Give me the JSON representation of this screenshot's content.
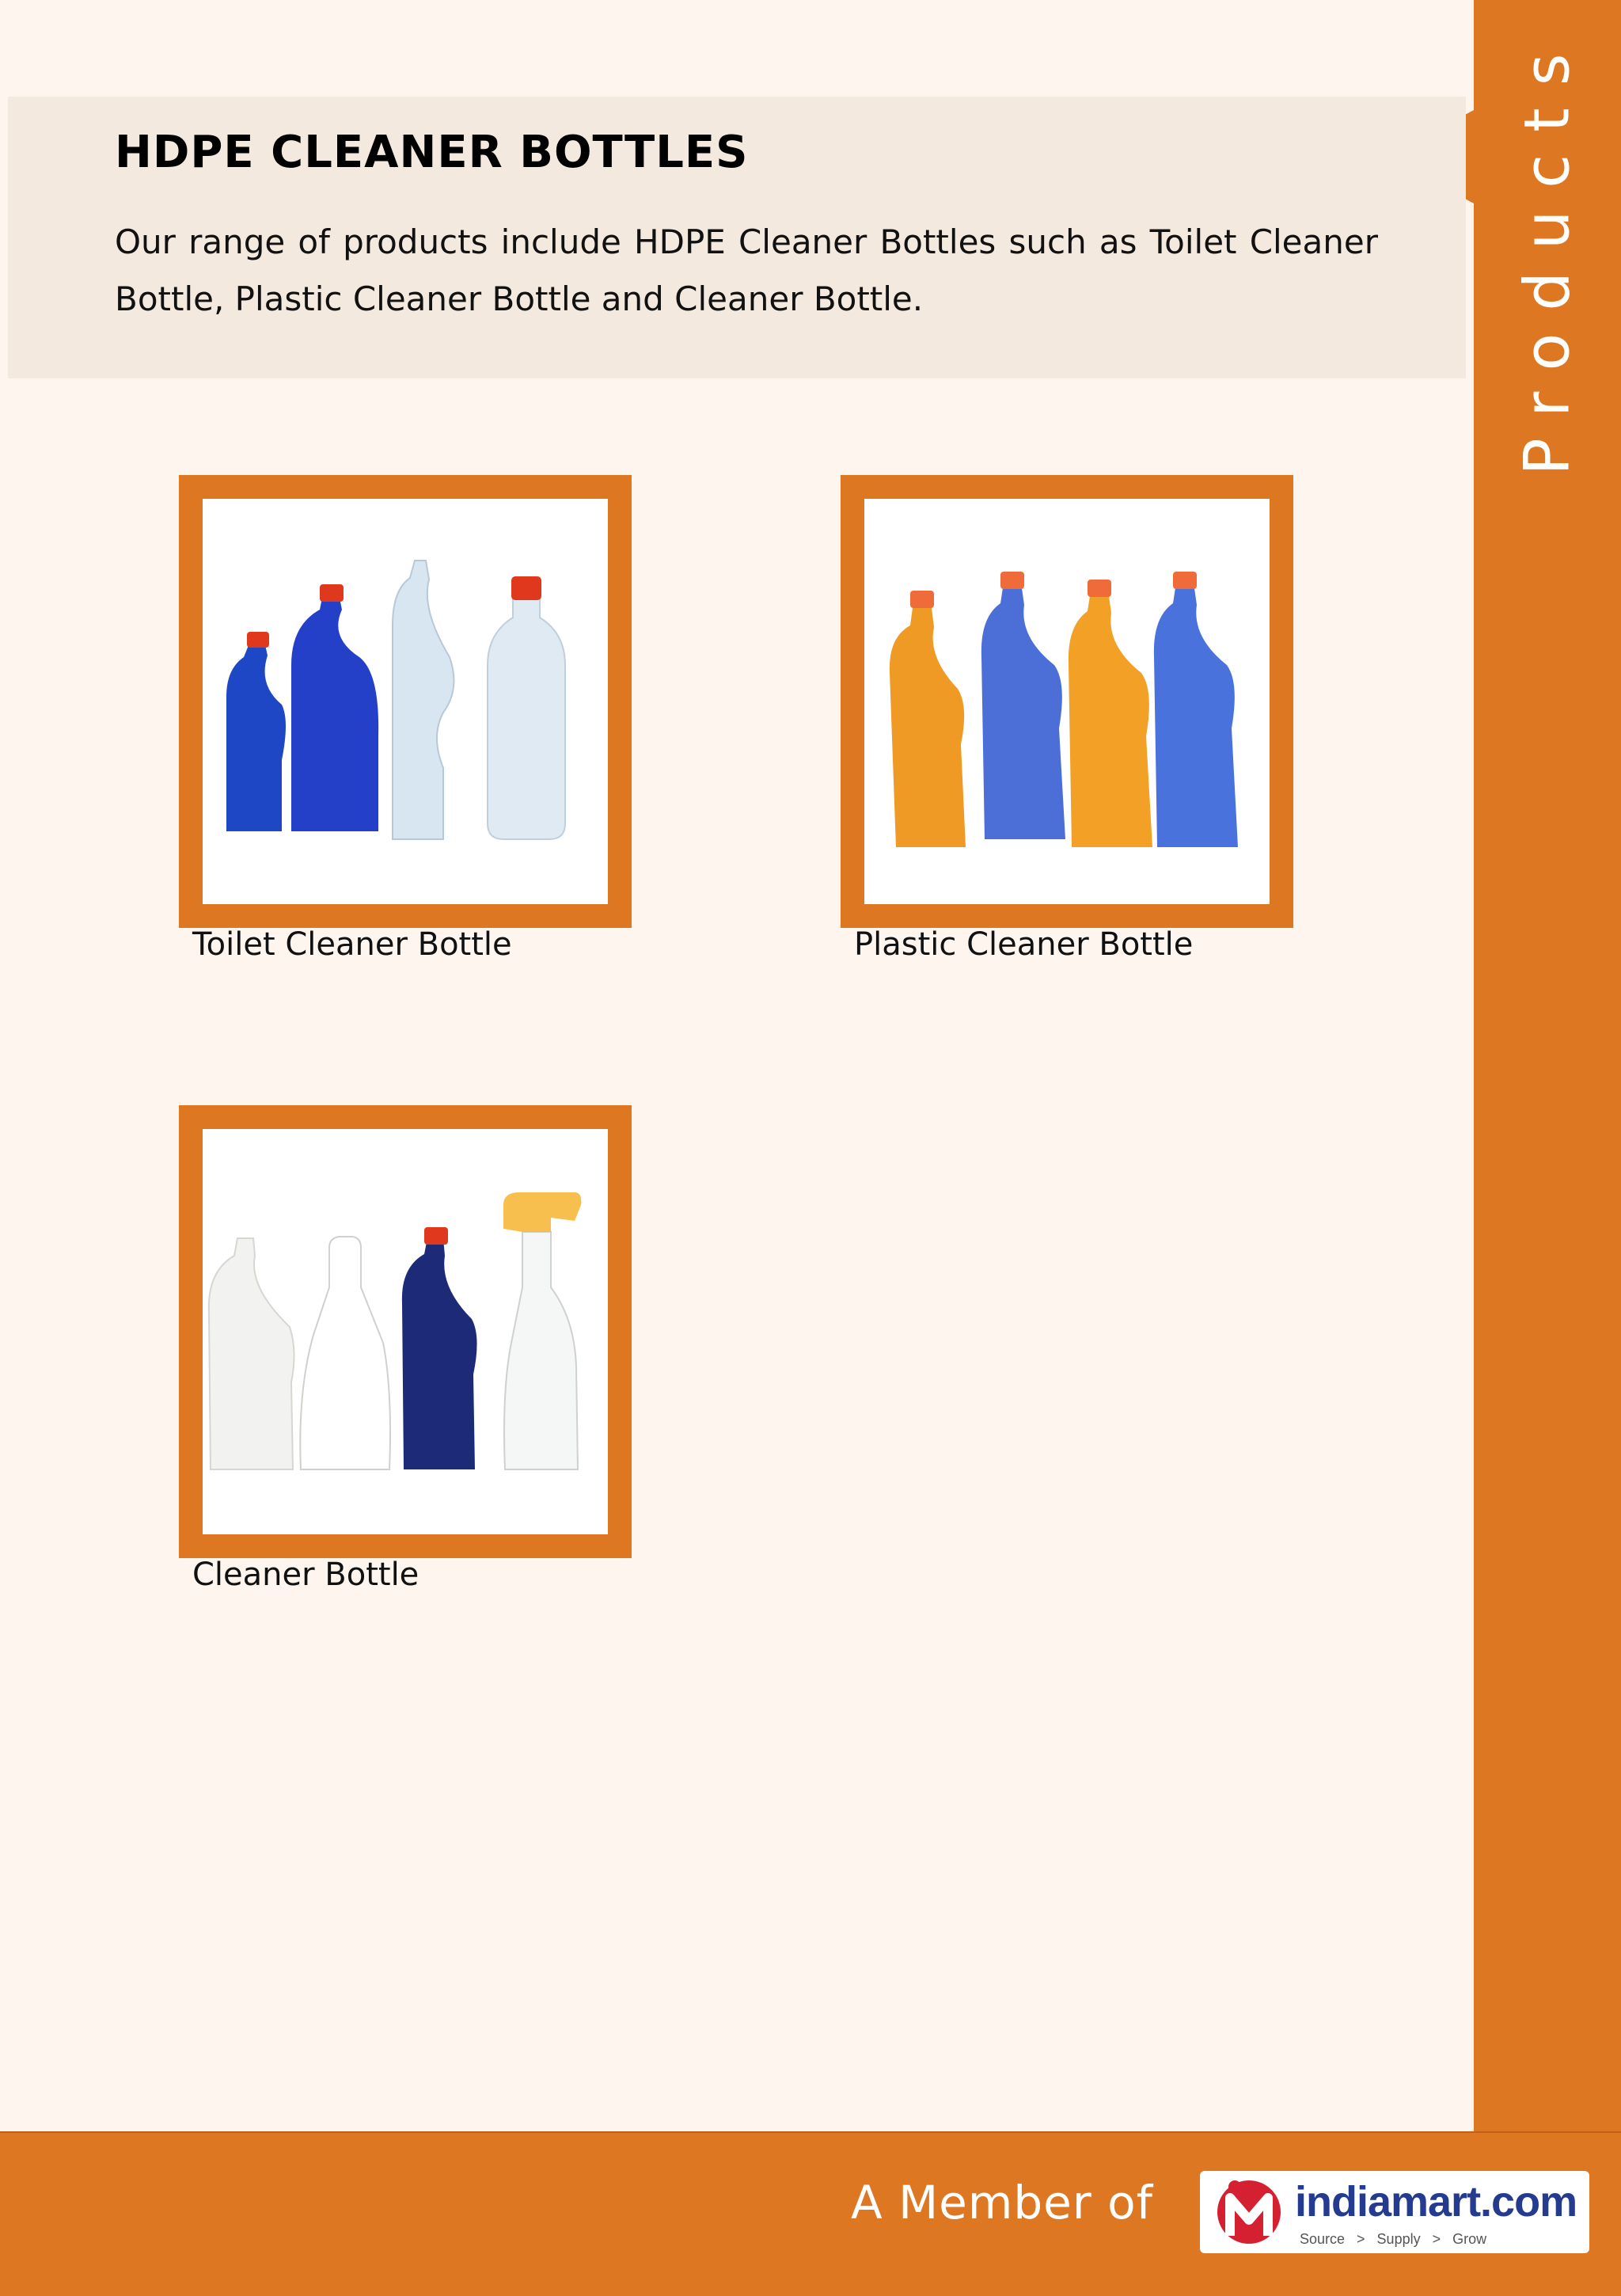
{
  "sidebar": {
    "label": "Products"
  },
  "header": {
    "title": "HDPE CLEANER BOTTLES",
    "description": "Our range of products include HDPE Cleaner Bottles such as Toilet Cleaner Bottle, Plastic Cleaner Bottle and Cleaner Bottle."
  },
  "products": [
    {
      "name": "Toilet Cleaner Bottle"
    },
    {
      "name": "Plastic Cleaner Bottle"
    },
    {
      "name": "Cleaner Bottle"
    }
  ],
  "footer": {
    "member_text": "A Member of",
    "logo": {
      "name": "indiamart.com",
      "tagline": "Source   >   Supply   >   Grow"
    }
  },
  "colors": {
    "accent": "#dd7722",
    "background": "#fdf5ee",
    "header_box": "#f4e9df"
  }
}
